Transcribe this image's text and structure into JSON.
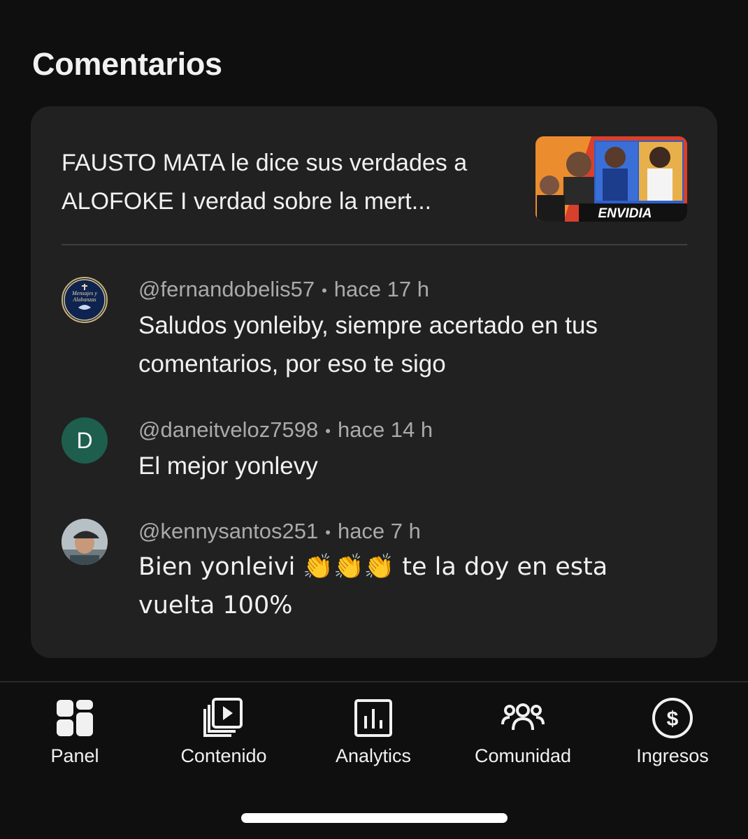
{
  "section_title": "Comentarios",
  "video": {
    "title": "FAUSTO MATA le dice sus verdades a ALOFOKE I verdad sobre la mert...",
    "thumbnail_caption": "ENVIDIA"
  },
  "comments": [
    {
      "handle": "@fernandobelis57",
      "time": "hace 17 h",
      "text": "Saludos yonleiby,  siempre acertado en tus comentarios, por eso te sigo",
      "avatar_text": "Mensajes y Alabanzas"
    },
    {
      "handle": "@daneitveloz7598",
      "time": "hace 14 h",
      "text": "El mejor yonlevy",
      "avatar_letter": "D"
    },
    {
      "handle": "@kennysantos251",
      "time": "hace 7 h",
      "text": "Bien yonleivi 👏👏👏 te la doy en esta vuelta 100%"
    }
  ],
  "nav": [
    {
      "label": "Panel",
      "icon": "dashboard-icon"
    },
    {
      "label": "Contenido",
      "icon": "content-icon"
    },
    {
      "label": "Analytics",
      "icon": "analytics-icon"
    },
    {
      "label": "Comunidad",
      "icon": "community-icon"
    },
    {
      "label": "Ingresos",
      "icon": "earnings-icon"
    }
  ],
  "colors": {
    "background": "#0f0f0f",
    "card": "#212121",
    "text": "#f1f1f1",
    "secondary_text": "#aaaaaa",
    "avatar_d": "#1d5f4c"
  }
}
